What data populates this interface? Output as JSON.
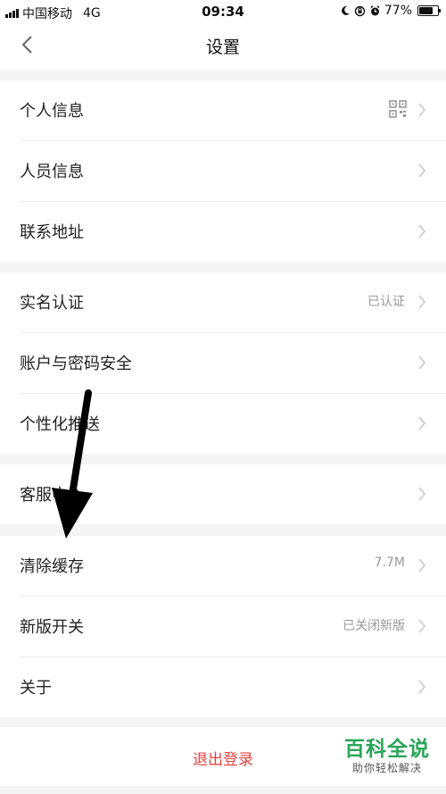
{
  "status_bar": {
    "carrier": "中国移动",
    "network": "4G",
    "time": "09:34",
    "battery": "77%",
    "battery_level": 0.77
  },
  "header": {
    "title": "设置"
  },
  "groups": [
    {
      "rows": [
        {
          "label": "个人信息",
          "value": "",
          "icon": "qr-code-icon"
        },
        {
          "label": "人员信息",
          "value": ""
        },
        {
          "label": "联系地址",
          "value": ""
        }
      ]
    },
    {
      "rows": [
        {
          "label": "实名认证",
          "value": "已认证"
        },
        {
          "label": "账户与密码安全",
          "value": ""
        },
        {
          "label": "个性化推送",
          "value": ""
        }
      ]
    },
    {
      "rows": [
        {
          "label": "客服中心",
          "value": ""
        }
      ]
    },
    {
      "rows": [
        {
          "label": "清除缓存",
          "value": "7.7M"
        },
        {
          "label": "新版开关",
          "value": "已关闭新版"
        },
        {
          "label": "关于",
          "value": ""
        }
      ]
    }
  ],
  "logout_label": "退出登录",
  "watermark": {
    "title": "百科全说",
    "subtitle": "助你轻松解决"
  },
  "colors": {
    "logout": "#e6423f",
    "watermark": "#2aa55a",
    "chevron": "#c8c8c8"
  }
}
